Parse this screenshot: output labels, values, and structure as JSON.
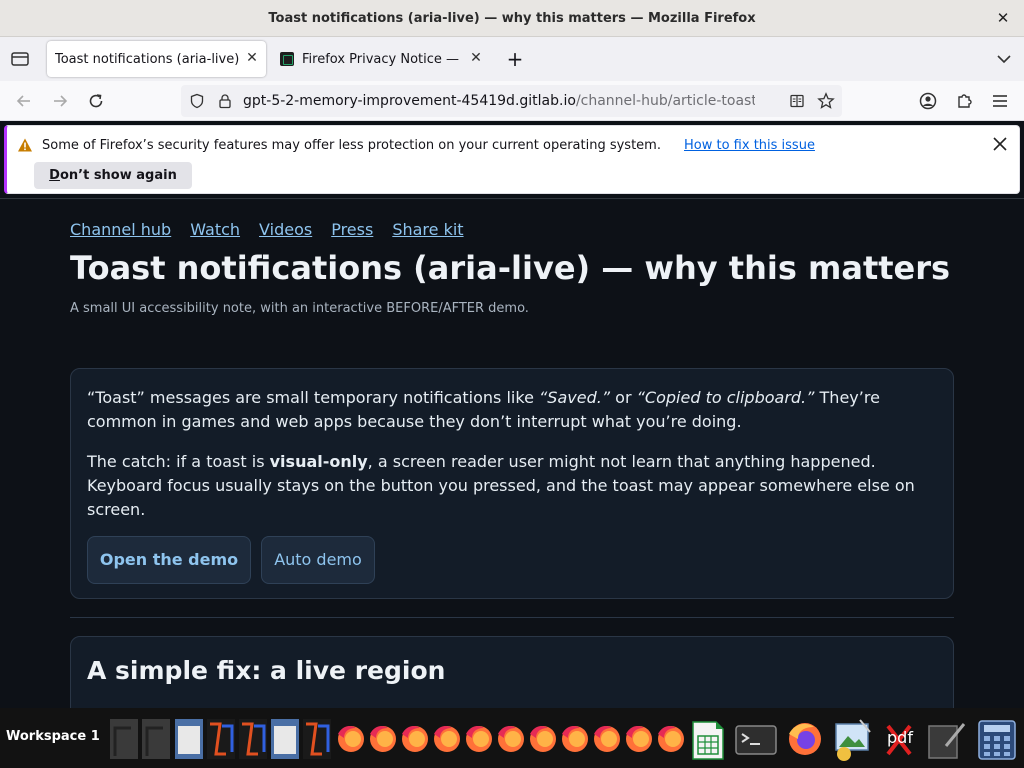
{
  "window": {
    "title": "Toast notifications (aria-live) — why this matters — Mozilla Firefox",
    "close_glyph": "✕"
  },
  "tabs": [
    {
      "label": "Toast notifications (aria-live)",
      "active": true,
      "close_glyph": "✕"
    },
    {
      "label": "Firefox Privacy Notice — Mo",
      "active": false,
      "close_glyph": "✕"
    }
  ],
  "new_tab_glyph": "+",
  "url": {
    "host": "gpt-5-2-memory-improvement-45419d.gitlab.io",
    "path": "/channel-hub/article-toast.html"
  },
  "notification": {
    "message": "Some of Firefox’s security features may offer less protection on your current operating system.",
    "link": "How to fix this issue",
    "button_underlined_letter": "D",
    "button_rest": "on’t show again"
  },
  "page": {
    "nav_links": [
      "Channel hub",
      "Watch",
      "Videos",
      "Press",
      "Share kit"
    ],
    "title": "Toast notifications (aria-live) — why this matters",
    "subtitle": "A small UI accessibility note, with an interactive BEFORE/AFTER demo.",
    "intro": {
      "p1_a": "“Toast” messages are small temporary notifications like ",
      "p1_em1": "“Saved.”",
      "p1_b": " or ",
      "p1_em2": "“Copied to clipboard.”",
      "p1_c": " They’re common in games and web apps because they don’t interrupt what you’re doing.",
      "p2_a": "The catch: if a toast is ",
      "p2_strong": "visual-only",
      "p2_b": ", a screen reader user might not learn that anything happened. Keyboard focus usually stays on the button you pressed, and the toast may appear somewhere else on screen.",
      "primary_button": "Open the demo",
      "secondary_button": "Auto demo"
    },
    "section2_heading": "A simple fix: a live region"
  },
  "taskbar": {
    "workspace_label": "Workspace 1",
    "pdf_label": "pdf",
    "icons": [
      "window-icon",
      "window-icon",
      "window-icon",
      "app-icon",
      "app-icon",
      "window-icon",
      "app-icon",
      "firefox-icon",
      "firefox-icon",
      "firefox-icon",
      "firefox-icon",
      "firefox-icon",
      "firefox-icon",
      "firefox-icon",
      "firefox-icon",
      "firefox-icon",
      "firefox-icon",
      "firefox-icon",
      "spreadsheet-icon",
      "terminal-icon",
      "firefox-icon",
      "image-viewer-icon",
      "close-app-icon",
      "pdf-icon",
      "text-editor-icon",
      "calculator-icon"
    ]
  }
}
